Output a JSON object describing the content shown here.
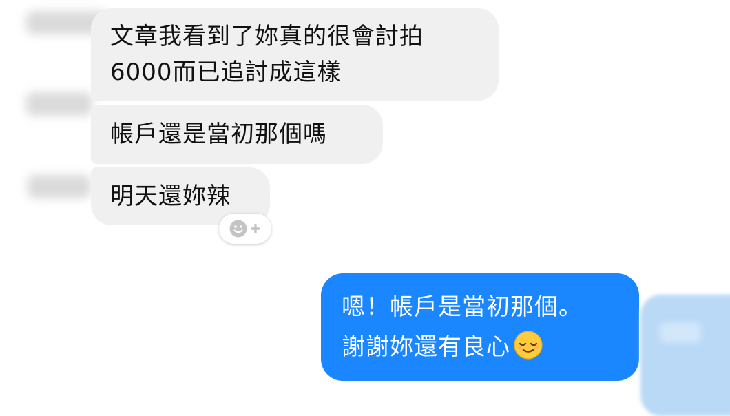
{
  "incoming_messages": [
    {
      "lines": [
        "文章我看到了妳真的很會討拍",
        "6000而已追討成這樣"
      ]
    },
    {
      "lines": [
        "帳戶還是當初那個嗎"
      ]
    },
    {
      "lines": [
        "明天還妳辣"
      ]
    }
  ],
  "outgoing_message": {
    "lines": [
      "嗯！帳戶是當初那個。",
      "謝謝妳還有良心"
    ],
    "emoji": "relieved-face"
  },
  "colors": {
    "incoming_bubble": "#f0f0f0",
    "outgoing_bubble": "#1a86ff",
    "outgoing_text": "#ffffff"
  },
  "icons": {
    "reaction": [
      "smiley-icon",
      "plus-icon"
    ]
  }
}
